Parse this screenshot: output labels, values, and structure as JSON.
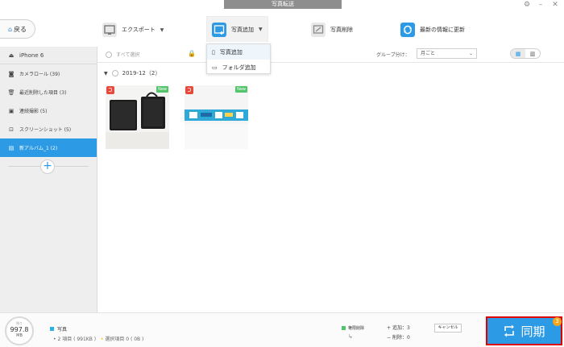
{
  "window": {
    "title": "写真転送"
  },
  "toolbar": {
    "back_label": "戻る",
    "export_label": "エクスポート",
    "add_photo_label": "写真追加",
    "delete_photo_label": "写真削除",
    "refresh_label": "最新の情報に更新"
  },
  "dropdown": {
    "items": [
      {
        "label": "写真追加"
      },
      {
        "label": "フォルダ追加"
      }
    ]
  },
  "sidebar": {
    "device": "iPhone 6",
    "items": [
      {
        "label": "カメラロール (39)"
      },
      {
        "label": "最近削除した項目 (3)"
      },
      {
        "label": "連続撮影 (5)"
      },
      {
        "label": "スクリーンショット (5)"
      },
      {
        "label": "新アルバム_1 (2)"
      }
    ]
  },
  "content_head": {
    "select_all": "すべて選択",
    "group_by_label": "グループ分け：",
    "group_by_value": "月ごと"
  },
  "content": {
    "date_group": "2019-12（2）",
    "new_badge": "New",
    "photos": [
      {
        "badge": "New"
      },
      {
        "badge": "New"
      }
    ]
  },
  "bottom": {
    "storage_caption": "残り",
    "storage_value": "997.8",
    "storage_unit": "MB",
    "type_label": "写真",
    "items_count": "2 項目 ( 991KB )",
    "selected_label": "選択項目 0 ( 0B )",
    "perm_delete": "権限削除",
    "add_count": "追加：3",
    "delete_count": "削除：0",
    "cancel_label": "キャンセル"
  },
  "sync": {
    "label": "同期",
    "badge": "3"
  },
  "colors": {
    "accent": "#2c9ae4",
    "highlight_border": "#e00000",
    "new_badge": "#52c56b",
    "dup_badge": "#e74a3b",
    "sync_badge": "#f2a61b"
  }
}
